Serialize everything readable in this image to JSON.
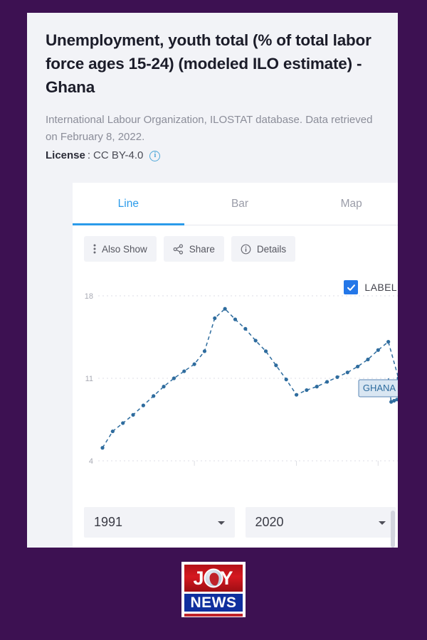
{
  "theme": {
    "page_background": "#3D1152",
    "card_background": "#F2F3F7",
    "panel_background": "#FFFFFF",
    "accent_blue": "#2B9BEA",
    "checkbox_blue": "#2477E8",
    "series_color": "#2E6C9E",
    "title_color": "#1B1C29",
    "muted_text": "#8B8D99"
  },
  "header": {
    "title": "Unemployment, youth total (% of total labor force ages 15-24) (modeled ILO estimate) - Ghana",
    "source": "International Labour Organization, ILOSTAT database. Data retrieved on February 8, 2022.",
    "license_label": "License",
    "license_separator": ":",
    "license_value": "CC BY-4.0",
    "info_icon": "info-circle-icon",
    "info_icon_glyph": "i"
  },
  "tabs": [
    {
      "label": "Line",
      "active": true
    },
    {
      "label": "Bar",
      "active": false
    },
    {
      "label": "Map",
      "active": false
    }
  ],
  "toolbar": [
    {
      "label": "Also Show",
      "icon": "vertical-dots-icon"
    },
    {
      "label": "Share",
      "icon": "share-icon"
    },
    {
      "label": "Details",
      "icon": "info-circle-icon"
    }
  ],
  "label_toggle": {
    "text": "LABEL",
    "checked": true,
    "icon": "checkmark-icon"
  },
  "year_range": {
    "start": {
      "value": "1991",
      "caret": "chevron-down-icon"
    },
    "end": {
      "value": "2020",
      "caret": "chevron-down-icon"
    }
  },
  "logo": {
    "line1": "JOY",
    "line2": "NEWS",
    "globe_icon": "globe-africa-icon"
  },
  "chart_data": {
    "type": "line",
    "title": "Unemployment, youth total (% of total labor force ages 15-24) (modeled ILO estimate) - Ghana",
    "xlabel": "",
    "ylabel": "",
    "series_label": "GHANA",
    "grid": true,
    "legend_position": "none",
    "ylim": [
      4,
      18
    ],
    "yticks": [
      4,
      11,
      18
    ],
    "ytick_labels": [
      "4",
      "11",
      "18"
    ],
    "xlim": [
      1991,
      2020
    ],
    "x": [
      1991,
      1992,
      1993,
      1994,
      1995,
      1996,
      1997,
      1998,
      1999,
      2000,
      2001,
      2002,
      2003,
      2004,
      2005,
      2006,
      2007,
      2008,
      2009,
      2010,
      2011,
      2012,
      2013,
      2014,
      2015,
      2016,
      2017,
      2018,
      2019,
      2020
    ],
    "values": [
      5.1,
      6.5,
      7.2,
      7.9,
      8.7,
      9.5,
      10.3,
      11.0,
      11.6,
      12.2,
      13.3,
      16.1,
      16.9,
      16.0,
      15.2,
      14.2,
      13.3,
      12.1,
      10.9,
      9.6,
      10.0,
      10.3,
      10.7,
      11.1,
      11.5,
      12.0,
      12.6,
      13.4,
      14.1,
      11.0
    ],
    "tail_values": [
      9.0,
      9.1,
      9.2,
      9.6
    ],
    "annotations": [
      {
        "text": "GHANA",
        "at_x": 2020,
        "at_y": 11.0
      }
    ]
  }
}
